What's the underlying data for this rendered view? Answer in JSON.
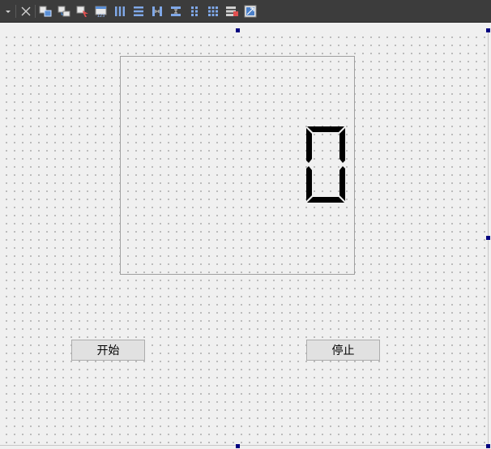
{
  "toolbar": {
    "tools": [
      {
        "icon": "dropdown-arrow-icon"
      },
      {
        "icon": "close-icon"
      },
      {
        "icon": "edit-widgets-icon"
      },
      {
        "icon": "edit-signals-slots-icon"
      },
      {
        "icon": "edit-buddies-icon"
      },
      {
        "icon": "edit-tab-order-icon"
      },
      {
        "icon": "layout-horizontal-icon"
      },
      {
        "icon": "layout-vertical-icon"
      },
      {
        "icon": "layout-horizontal-splitter-icon"
      },
      {
        "icon": "layout-vertical-splitter-icon"
      },
      {
        "icon": "layout-form-icon"
      },
      {
        "icon": "layout-grid-icon"
      },
      {
        "icon": "break-layout-icon"
      },
      {
        "icon": "adjust-size-icon"
      }
    ]
  },
  "form": {
    "lcd_value": "0",
    "start_button_label": "开始",
    "stop_button_label": "停止"
  },
  "colors": {
    "toolbar_bg": "#3c3c3c",
    "selection_handle": "#000080",
    "lcd_segment": "#000000"
  }
}
